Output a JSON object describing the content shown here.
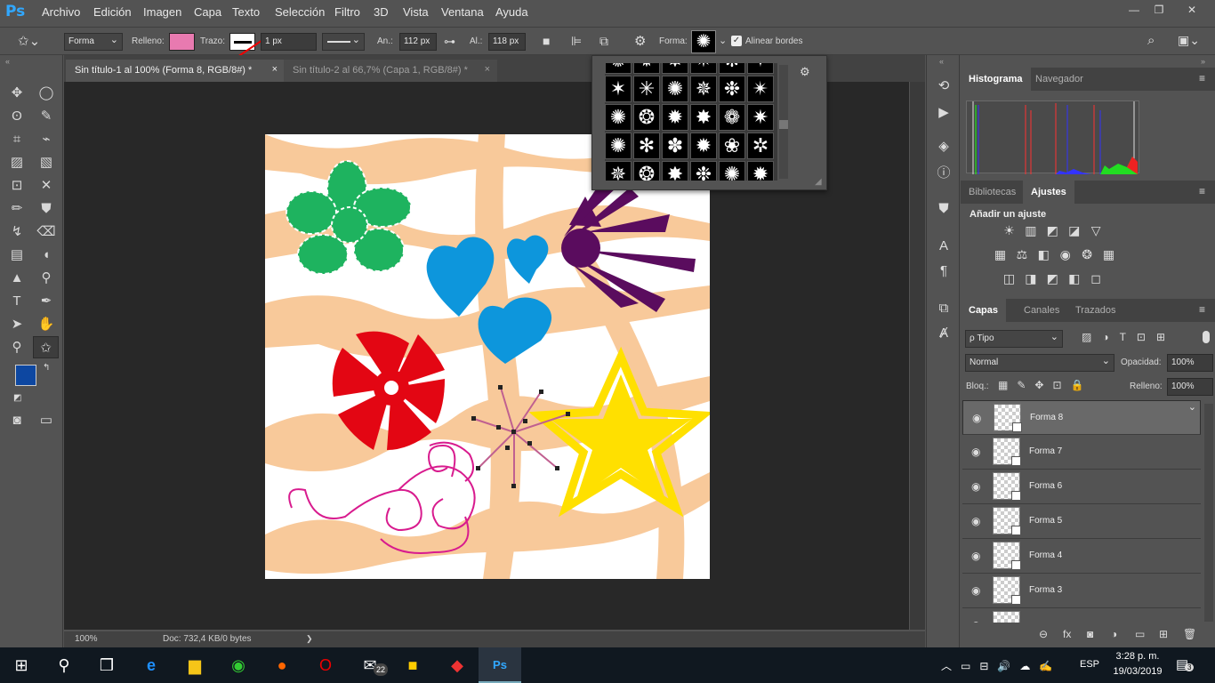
{
  "app": {
    "logo": "Ps"
  },
  "menu": [
    "Archivo",
    "Edición",
    "Imagen",
    "Capa",
    "Texto",
    "Selección",
    "Filtro",
    "3D",
    "Vista",
    "Ventana",
    "Ayuda"
  ],
  "window_controls": [
    "—",
    "❐",
    "✕"
  ],
  "options": {
    "tool_mode": "Forma",
    "fill_label": "Relleno:",
    "fill_color": "#e87ab0",
    "stroke_label": "Trazo:",
    "stroke_width": "1 px",
    "width_label": "An.:",
    "width_value": "112 px",
    "height_label": "Al.:",
    "height_value": "118 px",
    "shape_label": "Forma:",
    "align_edges": "Alinear bordes"
  },
  "tabs": [
    {
      "label": "Sin título-1 al 100% (Forma 8, RGB/8#) *",
      "close": "×"
    },
    {
      "label": "Sin título-2 al 66,7% (Capa 1, RGB/8#) *",
      "close": "×"
    }
  ],
  "status": {
    "zoom": "100%",
    "doc": "Doc: 732,4 KB/0 bytes",
    "arrow": "❯"
  },
  "colors": {
    "foreground": "#0d47a1",
    "background": "#ffffff",
    "accent": "#31a8ff"
  },
  "shape_picker": {
    "glyphs": [
      "✺",
      "✹",
      "✸",
      "✷",
      "❋",
      "✦",
      "✶",
      "✳",
      "✺",
      "✵",
      "❉",
      "✴",
      "✺",
      "❂",
      "✹",
      "✸",
      "❁",
      "✷",
      "✺",
      "✻",
      "✽",
      "✹",
      "❀",
      "✲",
      "✵",
      "❂",
      "✸",
      "❉",
      "✺",
      "✹"
    ],
    "gear": "⚙"
  },
  "histogram_panel": {
    "tabs": [
      "Histograma",
      "Navegador"
    ]
  },
  "adjust_panel": {
    "tabs": [
      "Bibliotecas",
      "Ajustes"
    ],
    "title": "Añadir un ajuste",
    "icons": [
      "☀",
      "▥",
      "◩",
      "◪",
      "▽",
      "▦",
      "⚖",
      "◧",
      "◉",
      "❂",
      "▦",
      "◫",
      "◨",
      "◩",
      "◧",
      "◻"
    ]
  },
  "layers_panel": {
    "tabs": [
      "Capas",
      "Canales",
      "Trazados"
    ],
    "filter": "ρ Tipo",
    "blend": "Normal",
    "opacity_label": "Opacidad:",
    "opacity": "100%",
    "lock_label": "Bloq.:",
    "fill_label": "Relleno:",
    "fill": "100%",
    "layers": [
      "Forma 8",
      "Forma 7",
      "Forma 6",
      "Forma 5",
      "Forma 4",
      "Forma 3"
    ],
    "footer_icons": [
      "⊖",
      "fx",
      "◙",
      "◑",
      "▭",
      "⊞",
      "🗑"
    ]
  },
  "taskbar": {
    "time": "3:28 p. m.",
    "date": "19/03/2019",
    "lang": "ESP",
    "mail_badge": "22",
    "notif": "3"
  }
}
